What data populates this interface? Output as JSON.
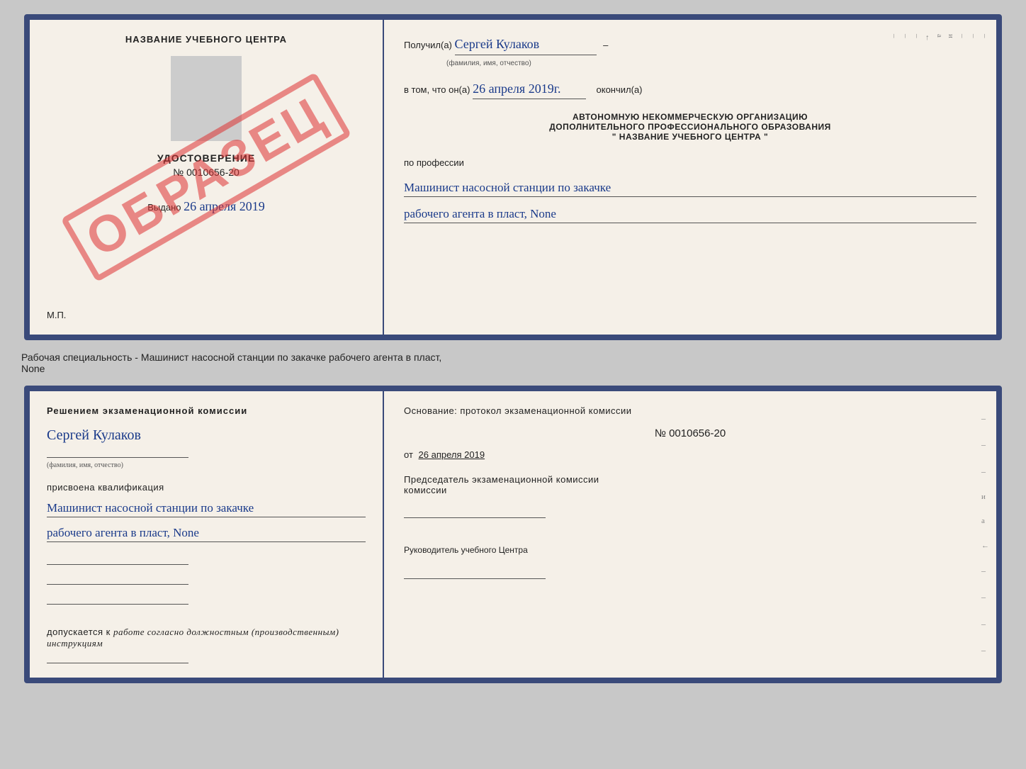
{
  "top_doc": {
    "left": {
      "title": "НАЗВАНИЕ УЧЕБНОГО ЦЕНТРА",
      "watermark": "ОБРАЗЕЦ",
      "udostoverenie_label": "УДОСТОВЕРЕНИЕ",
      "number": "№ 0010656-20",
      "vydano_label": "Выдано",
      "vydano_date": "26 апреля 2019",
      "mp_label": "М.П."
    },
    "right": {
      "poluchil_label": "Получил(а)",
      "poluchil_name": "Сергей Кулаков",
      "familiya_label": "(фамилия, имя, отчество)",
      "vtom_label": "в том, что он(а)",
      "vtom_date": "26 апреля 2019г.",
      "okonchil_label": "окончил(а)",
      "org_line1": "АВТОНОМНУЮ НЕКОММЕРЧЕСКУЮ ОРГАНИЗАЦИЮ",
      "org_line2": "ДОПОЛНИТЕЛЬНОГО ПРОФЕССИОНАЛЬНОГО ОБРАЗОВАНИЯ",
      "org_line3": "\"  НАЗВАНИЕ УЧЕБНОГО ЦЕНТРА  \"",
      "po_professii_label": "по профессии",
      "profession_line1": "Машинист насосной станции по закачке",
      "profession_line2": "рабочего агента в пласт, None"
    }
  },
  "subtitle": "Рабочая специальность - Машинист насосной станции по закачке рабочего агента в пласт,\nNone",
  "bottom_doc": {
    "left": {
      "resheniem_label": "Решением экзаменационной комиссии",
      "name": "Сергей Кулаков",
      "familiya_label": "(фамилия, имя, отчество)",
      "prisvoena_label": "присвоена квалификация",
      "qual_line1": "Машинист насосной станции по закачке",
      "qual_line2": "рабочего агента в пласт, None",
      "dopuskaetsya_label": "допускается к",
      "dopuskaetsya_value": "работе согласно должностным (производственным) инструкциям"
    },
    "right": {
      "osnovanie_label": "Основание: протокол экзаменационной комиссии",
      "number": "№ 0010656-20",
      "ot_label": "от",
      "date": "26 апреля 2019",
      "predsedatel_label": "Председатель экзаменационной комиссии",
      "rukovoditel_label": "Руководитель учебного Центра"
    }
  }
}
